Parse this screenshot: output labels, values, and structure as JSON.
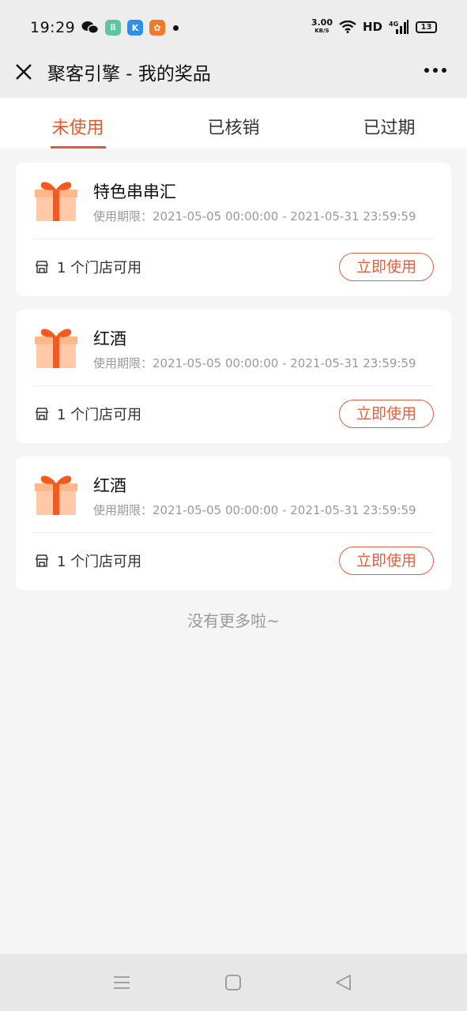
{
  "status_bar": {
    "time": "19:29",
    "net_speed": "3.00",
    "net_unit": "KB/S",
    "hd": "HD",
    "signal": "4G",
    "battery": "13"
  },
  "nav": {
    "title": "聚客引擎 - 我的奖品"
  },
  "tabs": [
    {
      "label": "未使用",
      "active": true
    },
    {
      "label": "已核销",
      "active": false
    },
    {
      "label": "已过期",
      "active": false
    }
  ],
  "prizes": [
    {
      "title": "特色串串汇",
      "validity": "使用期限：2021-05-05 00:00:00 - 2021-05-31 23:59:59",
      "stores": "1 个门店可用",
      "action": "立即使用"
    },
    {
      "title": "红酒",
      "validity": "使用期限：2021-05-05 00:00:00 - 2021-05-31 23:59:59",
      "stores": "1 个门店可用",
      "action": "立即使用"
    },
    {
      "title": "红酒",
      "validity": "使用期限：2021-05-05 00:00:00 - 2021-05-31 23:59:59",
      "stores": "1 个门店可用",
      "action": "立即使用"
    }
  ],
  "footer_text": "没有更多啦~",
  "colors": {
    "accent": "#e8572a",
    "button_border": "#e06040",
    "background": "#f5f5f5"
  }
}
